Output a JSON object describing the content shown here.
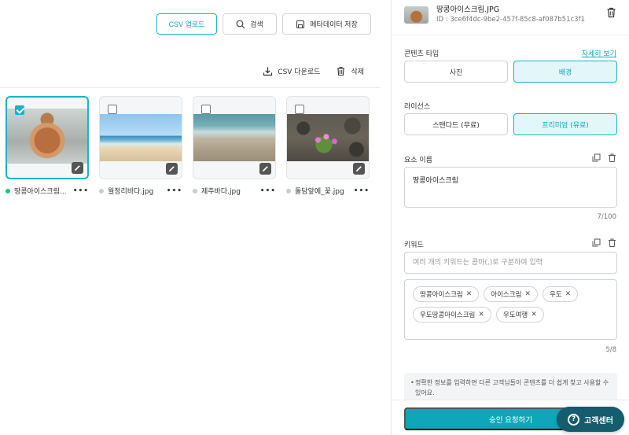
{
  "toolbar": {
    "csv_upload": "CSV 업로드",
    "search": "검색",
    "save_metadata": "메타데이터 저장",
    "csv_download": "CSV 다운로드",
    "delete": "삭제"
  },
  "files": [
    {
      "name": "땅콩아이스크림...",
      "selected": true,
      "status": "complete"
    },
    {
      "name": "월정리바다.jpg",
      "selected": false,
      "status": "incomplete"
    },
    {
      "name": "제주바다.jpg",
      "selected": false,
      "status": "incomplete"
    },
    {
      "name": "돌담앞에_꽃.jpg",
      "selected": false,
      "status": "incomplete"
    }
  ],
  "detail": {
    "file_name": "땅콩아이스크림.JPG",
    "file_id": "ID : 3ce6f4dc-9be2-457f-85c8-af087b51c3f1",
    "content_type_label": "콘텐츠 타입",
    "detail_link": "자세히 보기",
    "content_type_options": [
      "사진",
      "배경"
    ],
    "content_type_selected": "배경",
    "license_label": "라이선스",
    "license_options": [
      "스탠다드 (무료)",
      "프리미엄 (유료)"
    ],
    "license_selected": "프리미엄 (유료)",
    "element_name_label": "요소 이름",
    "element_name_value": "땅콩아이스크림",
    "element_name_counter": "7/100",
    "keyword_label": "키워드",
    "keyword_placeholder": "여러 개의 키워드는 콤마(,)로 구분하여 입력",
    "keywords": [
      "땅콩아이스크림",
      "아이스크림",
      "우도",
      "우도땅콩아이스크림",
      "우도여행"
    ],
    "keyword_counter": "5/8",
    "notice": "정확한 정보를 입력하면 다른 고객님들이 콘텐츠를 더 쉽게 찾고 사용할 수 있어요.",
    "approve_button": "승인 요청하기",
    "help_button": "고객센터",
    "help_icon": "?"
  },
  "colors": {
    "accent": "#0fa6b9",
    "accent_light": "#e3f7fa",
    "help_bg": "#145c6e",
    "status_ok": "#22c37a"
  }
}
